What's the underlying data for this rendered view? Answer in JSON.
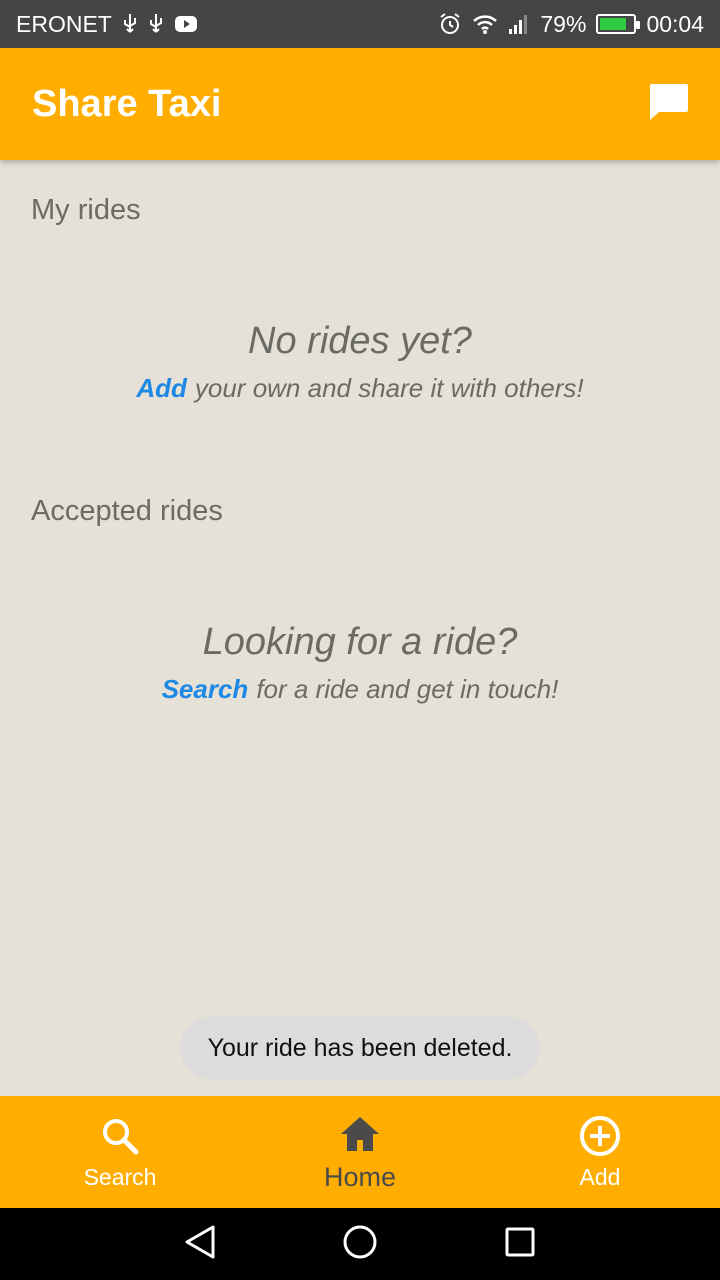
{
  "status_bar": {
    "carrier": "ERONET",
    "battery_percent": "79%",
    "battery_level": 0.79,
    "time": "00:04",
    "icons": [
      "usb-icon",
      "usb-icon",
      "youtube-icon",
      "alarm-icon",
      "wifi-icon",
      "signal-icon",
      "battery-icon"
    ]
  },
  "app_bar": {
    "title": "Share Taxi",
    "chat_icon": "chat-icon",
    "color": "#ffad00"
  },
  "my_rides": {
    "title": "My rides",
    "empty_heading": "No rides yet?",
    "link": "Add",
    "text": "your own and share it with others!"
  },
  "accepted_rides": {
    "title": "Accepted rides",
    "empty_heading": "Looking for a ride?",
    "link": "Search",
    "text": "for a ride and get in touch!"
  },
  "toast": {
    "message": "Your ride has been deleted."
  },
  "bottom_nav": {
    "items": [
      {
        "label": "Search",
        "icon": "search-icon",
        "active": false
      },
      {
        "label": "Home",
        "icon": "home-icon",
        "active": true
      },
      {
        "label": "Add",
        "icon": "add-circle-icon",
        "active": false
      }
    ]
  },
  "system_nav": {
    "icons": [
      "back-icon",
      "home-circle-icon",
      "recents-icon"
    ]
  },
  "colors": {
    "accent": "#ffad00",
    "link": "#1e88e5",
    "background": "#e5e1d6"
  }
}
